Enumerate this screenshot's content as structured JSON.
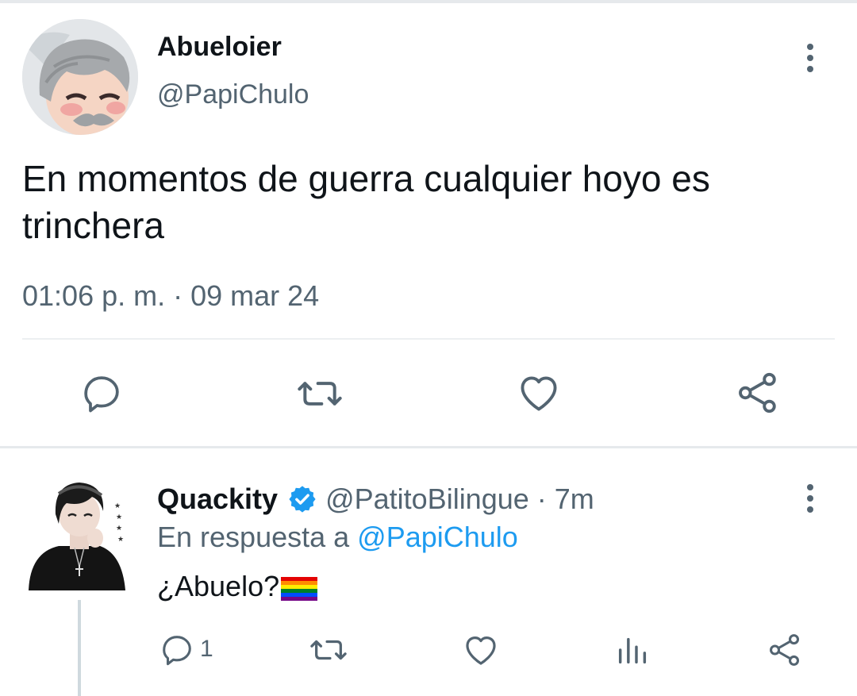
{
  "main_tweet": {
    "author_name": "Abueloier",
    "handle": "@PapiChulo",
    "text": "En momentos de guerra cualquier hoyo es trinchera",
    "timestamp": "01:06 p. m. · 09 mar 24",
    "avatar_icon": "cartoon-grandpa-avatar",
    "actions": [
      "reply-icon",
      "retweet-icon",
      "like-icon",
      "share-icon"
    ]
  },
  "reply_tweet": {
    "author_name": "Quackity",
    "verified": true,
    "handle": "@PatitoBilingue",
    "age": "· 7m",
    "replying_prefix": "En respuesta a",
    "replying_to": "@PapiChulo",
    "text": "¿Abuelo?",
    "emoji": "rainbow-flag",
    "reply_count": "1",
    "actions": [
      "reply-icon",
      "retweet-icon",
      "like-icon",
      "analytics-icon",
      "share-icon"
    ]
  },
  "colors": {
    "text": "#0f1419",
    "secondary": "#536471",
    "accent": "#1d9bf0",
    "divider": "#e6e9ec"
  }
}
